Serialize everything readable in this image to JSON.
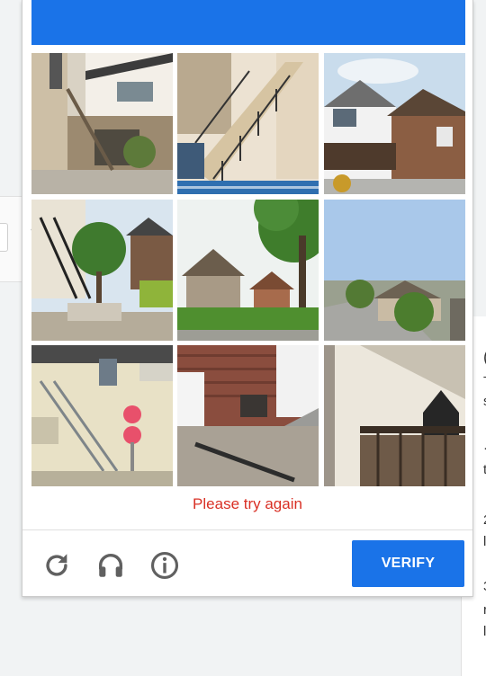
{
  "captcha": {
    "colors": {
      "header": "#1a73e8",
      "error": "#d93025",
      "verify": "#1a73e8"
    },
    "tiles": [
      {
        "subject": "house-with-outdoor-staircase"
      },
      {
        "subject": "exterior-staircase-with-railing"
      },
      {
        "subject": "house-with-porch"
      },
      {
        "subject": "house-with-outdoor-staircase-and-tree"
      },
      {
        "subject": "suburban-house-with-lawn"
      },
      {
        "subject": "street-with-houses"
      },
      {
        "subject": "building-with-external-stairs"
      },
      {
        "subject": "brick-wall-with-steps"
      },
      {
        "subject": "house-balcony"
      }
    ],
    "error_message": "Please try again",
    "footer": {
      "reload_icon": "reload-icon",
      "audio_icon": "headphones-icon",
      "info_icon": "info-icon",
      "verify_label": "VERIFY"
    }
  }
}
